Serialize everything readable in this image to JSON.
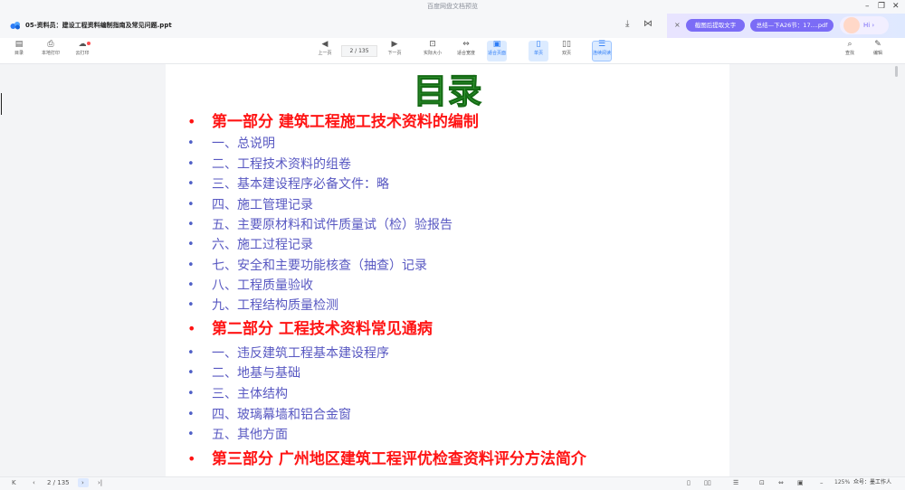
{
  "window": {
    "title": "百度网盘文档预览",
    "controls": {
      "minimize": "–",
      "restore": "❐",
      "close": "✕"
    }
  },
  "header": {
    "doc_title": "05-资料员：建设工程资料编制指南及常见问题.ppt",
    "download_icon": "download-icon",
    "share_icon": "share-icon"
  },
  "ai_panel": {
    "close_label": "×",
    "pill_extract": "截图后提取文字",
    "pill_summary": "总结—下A26节：17....pdf",
    "assistant_label": "Hi ›"
  },
  "toolbar": {
    "left": [
      {
        "icon": "▤",
        "label": "目录"
      },
      {
        "icon": "⎙",
        "label": "本地打印"
      },
      {
        "icon": "☁",
        "label": "云打印"
      }
    ],
    "prev_icon": "◀",
    "prev_label": "上一页",
    "page_indicator": "2 / 135",
    "next_icon": "▶",
    "next_label": "下一页",
    "view_items": [
      {
        "icon": "⊡",
        "label": "实际大小"
      },
      {
        "icon": "⇔",
        "label": "适合宽度"
      },
      {
        "icon": "▣",
        "label": "适合页面"
      },
      {
        "icon": "▯",
        "label": "单页"
      },
      {
        "icon": "▯▯",
        "label": "双页"
      },
      {
        "icon": "☰",
        "label": "连续阅读"
      }
    ],
    "search_icon": "⌕",
    "search_label": "查找",
    "edit_icon": "✎",
    "edit_label": "编辑"
  },
  "slide": {
    "title": "目录",
    "items": [
      {
        "text": "第一部分  建筑工程施工技术资料的编制",
        "level": "major"
      },
      {
        "text": "一、总说明",
        "level": "minor"
      },
      {
        "text": "二、工程技术资料的组卷",
        "level": "minor"
      },
      {
        "text": "三、基本建设程序必备文件：略",
        "level": "minor"
      },
      {
        "text": "四、施工管理记录",
        "level": "minor"
      },
      {
        "text": "五、主要原材料和试件质量试（检）验报告",
        "level": "minor"
      },
      {
        "text": "六、施工过程记录",
        "level": "minor"
      },
      {
        "text": "七、安全和主要功能核查（抽查）记录",
        "level": "minor"
      },
      {
        "text": "八、工程质量验收",
        "level": "minor"
      },
      {
        "text": "九、工程结构质量检测",
        "level": "minor"
      },
      {
        "text": "第二部分  工程技术资料常见通病",
        "level": "major"
      },
      {
        "text": " 一、违反建筑工程基本建设程序",
        "level": "minor"
      },
      {
        "text": " 二、地基与基础",
        "level": "minor"
      },
      {
        "text": " 三、主体结构",
        "level": "minor"
      },
      {
        "text": " 四、玻璃幕墙和铝合金窗",
        "level": "minor"
      },
      {
        "text": " 五、其他方面",
        "level": "minor"
      },
      {
        "text": "第三部分  广州地区建筑工程评优检查资料评分方法简介",
        "level": "major"
      }
    ]
  },
  "statusbar": {
    "first": "K",
    "prev": "‹",
    "page": "2 / 135",
    "next": "›",
    "last": "›|",
    "zoom": "125%",
    "zoom_out": "–",
    "zoom_in": "+",
    "watermark": "众号：墨工作人"
  }
}
